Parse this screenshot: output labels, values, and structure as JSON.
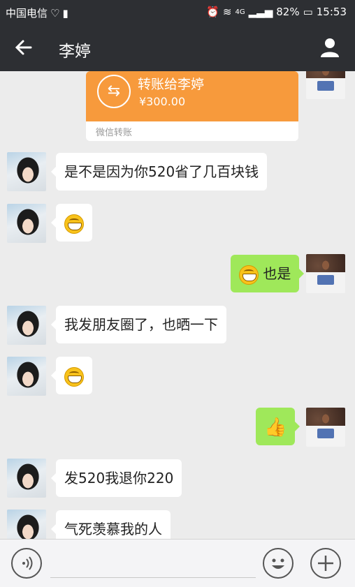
{
  "status_bar": {
    "carrier": "中国电信",
    "battery": "82%",
    "time": "15:53",
    "network": "4G"
  },
  "header": {
    "title": "李婷"
  },
  "transfer_card": {
    "title": "转账给李婷",
    "amount": "¥300.00",
    "label": "微信转账"
  },
  "messages": [
    {
      "side": "left",
      "text": "是不是因为你520省了几百块钱"
    },
    {
      "side": "left",
      "icon": "grin-emoji"
    },
    {
      "side": "right",
      "text": "也是",
      "icon": "grin-emoji"
    },
    {
      "side": "left",
      "text": "我发朋友圈了，也晒一下"
    },
    {
      "side": "left",
      "icon": "grin-emoji"
    },
    {
      "side": "right",
      "icon": "thumbs-up-emoji"
    },
    {
      "side": "left",
      "text": "发520我退你220"
    },
    {
      "side": "left",
      "text": "气死羡慕我的人"
    }
  ],
  "colors": {
    "bar_bg": "#2d2f33",
    "chat_bg": "#ececec",
    "sent_bubble": "#9fe85a",
    "transfer_orange": "#f79a3c"
  },
  "input_bar": {
    "voice_icon": "voice-icon",
    "emoji_icon": "emoji-icon",
    "plus_icon": "plus-icon"
  }
}
